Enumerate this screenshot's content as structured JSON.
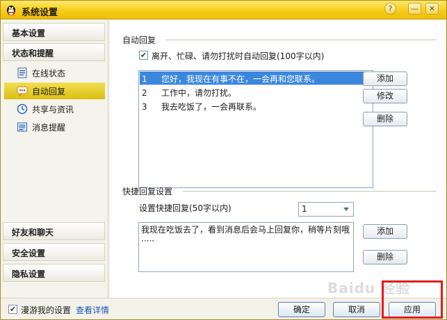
{
  "window": {
    "title": "系统设置",
    "help_label": "?",
    "minimize_label": "—",
    "close_label": "✕",
    "accent": "#f3c41a"
  },
  "sidebar": {
    "basic": "基本设置",
    "status": "状态和提醒",
    "items": [
      {
        "label": "在线状态",
        "icon": "online-status-icon"
      },
      {
        "label": "自动回复",
        "icon": "auto-reply-icon"
      },
      {
        "label": "共享与资讯",
        "icon": "clock-icon"
      },
      {
        "label": "消息提醒",
        "icon": "message-reminder-icon"
      }
    ],
    "friends": "好友和聊天",
    "security": "安全设置",
    "privacy": "隐私设置"
  },
  "auto_reply": {
    "group_title": "自动回复",
    "checkbox_label": "离开、忙碌、请勿打扰时自动回复(100字以内)",
    "checked": true,
    "rows": [
      {
        "num": "1",
        "text": "您好，我现在有事不在，一会再和您联系。"
      },
      {
        "num": "2",
        "text": "工作中，请勿打扰。"
      },
      {
        "num": "3",
        "text": "我去吃饭了，一会再联系。"
      }
    ],
    "add": "添加",
    "edit": "修改",
    "delete": "删除"
  },
  "quick_reply": {
    "group_title": "快捷回复设置",
    "set_label": "设置快捷回复(50字以内)",
    "selected": "1",
    "text": "我现在吃饭去了，看到消息后会马上回复你，稍等片刻哦·····",
    "add": "添加",
    "delete": "删除"
  },
  "footer": {
    "roam_label": "漫游我的设置",
    "roam_checked": true,
    "details_link": "查看详情",
    "ok": "确定",
    "cancel": "取消",
    "apply": "应用",
    "highlight_color": "#e31c1c"
  },
  "watermark": "Baidu 经验"
}
